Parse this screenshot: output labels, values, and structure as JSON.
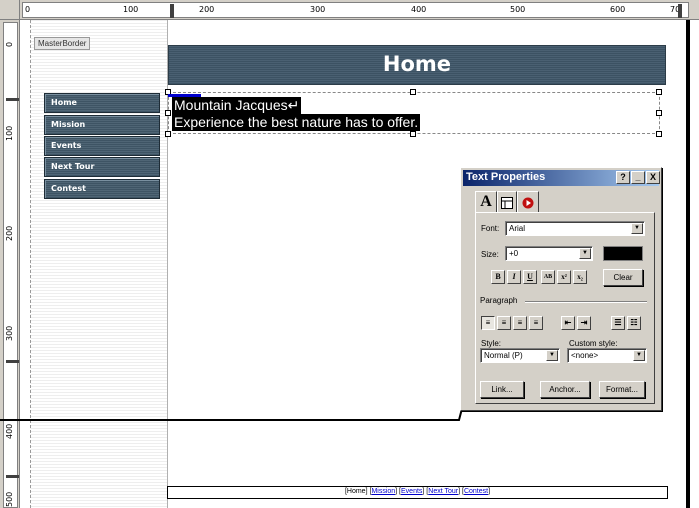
{
  "rulers": {
    "top_labels": [
      "0",
      "100",
      "200",
      "300",
      "400",
      "500",
      "600",
      "70"
    ],
    "left_labels": [
      "0",
      "100",
      "200",
      "300",
      "400",
      "500"
    ]
  },
  "master_border": {
    "tag": "MasterBorder"
  },
  "banner": {
    "title": "Home"
  },
  "nav": {
    "items": [
      {
        "label": "Home"
      },
      {
        "label": "Mission"
      },
      {
        "label": "Events"
      },
      {
        "label": "Next Tour"
      },
      {
        "label": "Contest"
      }
    ]
  },
  "content": {
    "line1": "Mountain Jacques",
    "line2": "Experience the best nature has to offer."
  },
  "text_properties": {
    "title": "Text Properties",
    "title_buttons": [
      "?",
      "_",
      "X"
    ],
    "tabs": [
      "A",
      "table",
      "record"
    ],
    "font_label": "Font:",
    "font_value": "Arial",
    "size_label": "Size:",
    "size_value": "+0",
    "format_buttons": [
      "B",
      "I",
      "U",
      "AB",
      "x²",
      "x₂"
    ],
    "clear_label": "Clear",
    "paragraph_label": "Paragraph",
    "style_label": "Style:",
    "style_value": "Normal (P)",
    "custom_style_label": "Custom style:",
    "custom_style_value": "<none>",
    "link_label": "Link...",
    "anchor_label": "Anchor...",
    "format_label": "Format...",
    "text_color": "#000000"
  },
  "footer": {
    "links": [
      "Home",
      "Mission",
      "Events",
      "Next Tour",
      "Contest"
    ]
  }
}
